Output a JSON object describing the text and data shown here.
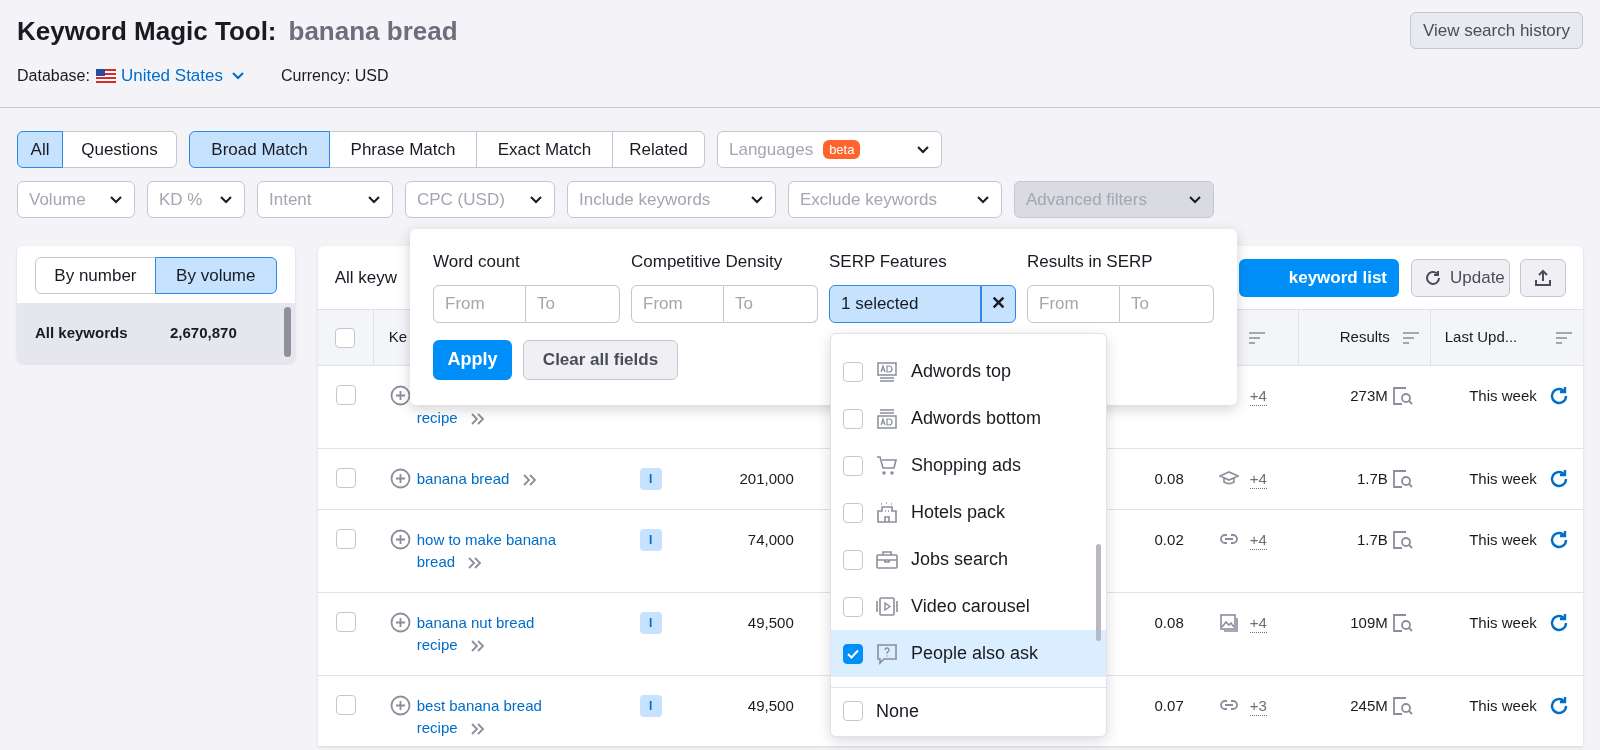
{
  "header": {
    "title": "Keyword Magic Tool:",
    "query": "banana bread",
    "database_label": "Database:",
    "database": "United States",
    "currency": "Currency: USD",
    "history_button": "View search history"
  },
  "match_tabs": [
    {
      "label": "All",
      "selected": true
    },
    {
      "label": "Questions",
      "selected": false
    }
  ],
  "type_tabs": [
    {
      "label": "Broad Match",
      "selected": true
    },
    {
      "label": "Phrase Match",
      "selected": false
    },
    {
      "label": "Exact Match",
      "selected": false
    },
    {
      "label": "Related",
      "selected": false
    }
  ],
  "languages": {
    "label": "Languages",
    "badge": "beta"
  },
  "filters": [
    {
      "label": "Volume",
      "open": false
    },
    {
      "label": "KD %",
      "open": false
    },
    {
      "label": "Intent",
      "open": false
    },
    {
      "label": "CPC (USD)",
      "open": false
    },
    {
      "label": "Include keywords",
      "open": false
    },
    {
      "label": "Exclude keywords",
      "open": false
    },
    {
      "label": "Advanced filters",
      "open": true
    }
  ],
  "sidebar": {
    "toggle": [
      {
        "label": "By number",
        "selected": false
      },
      {
        "label": "By volume",
        "selected": true
      }
    ],
    "groups": [
      {
        "label": "All keywords",
        "count": "2,670,870",
        "selected": true
      }
    ]
  },
  "table": {
    "title": "All keyw",
    "add_button": "keyword list",
    "update_button": "Update",
    "header_checked": false,
    "columns": [
      {
        "label": "Ke"
      },
      {
        "label": "Results"
      },
      {
        "label": "Last Upd..."
      }
    ],
    "rows": [
      {
        "checked": false,
        "keyword": "recipe",
        "serp": {
          "count": "+4"
        },
        "results": "273M",
        "last_update": "This week"
      },
      {
        "checked": false,
        "keyword": "banana bread",
        "intent": "I",
        "column_4": "201,000",
        "column_6": "0.08",
        "serp": {
          "kind": "cap",
          "count": "+4"
        },
        "results": "1.7B",
        "last_update": "This week"
      },
      {
        "checked": false,
        "keyword": "how to make banana bread",
        "intent": "I",
        "column_4": "74,000",
        "column_6": "0.02",
        "serp": {
          "kind": "link",
          "count": "+4"
        },
        "results": "1.7B",
        "last_update": "This week"
      },
      {
        "checked": false,
        "keyword": "banana nut bread recipe",
        "intent": "I",
        "column_4": "49,500",
        "column_6": "0.08",
        "serp": {
          "kind": "image",
          "count": "+4"
        },
        "results": "109M",
        "last_update": "This week"
      },
      {
        "checked": false,
        "keyword": "best banana bread recipe",
        "intent": "I",
        "column_4": "49,500",
        "column_6": "0.07",
        "serp": {
          "kind": "link",
          "count": "+3"
        },
        "results": "245M",
        "last_update": "This week"
      }
    ]
  },
  "advanced_filters": {
    "fields": [
      {
        "label": "Word count",
        "kind": "range",
        "from_placeholder": "From",
        "to_placeholder": "To"
      },
      {
        "label": "Competitive Density",
        "kind": "range",
        "from_placeholder": "From",
        "to_placeholder": "To"
      },
      {
        "label": "SERP Features",
        "kind": "select",
        "value": "1 selected",
        "clear": "✕"
      },
      {
        "label": "Results in SERP",
        "kind": "range",
        "from_placeholder": "From",
        "to_placeholder": "To"
      }
    ],
    "apply": "Apply",
    "clear": "Clear all fields"
  },
  "serp_dropdown": {
    "options": [
      {
        "label": "Adwords top",
        "kind": "adtop",
        "checked": false
      },
      {
        "label": "Adwords bottom",
        "kind": "adbottom",
        "checked": false
      },
      {
        "label": "Shopping ads",
        "kind": "cart",
        "checked": false
      },
      {
        "label": "Hotels pack",
        "kind": "hotel",
        "checked": false
      },
      {
        "label": "Jobs search",
        "kind": "briefcase",
        "checked": false
      },
      {
        "label": "Video carousel",
        "kind": "video",
        "checked": false
      },
      {
        "label": "People also ask",
        "kind": "question",
        "checked": true
      }
    ],
    "none": {
      "label": "None",
      "checked": false
    }
  }
}
